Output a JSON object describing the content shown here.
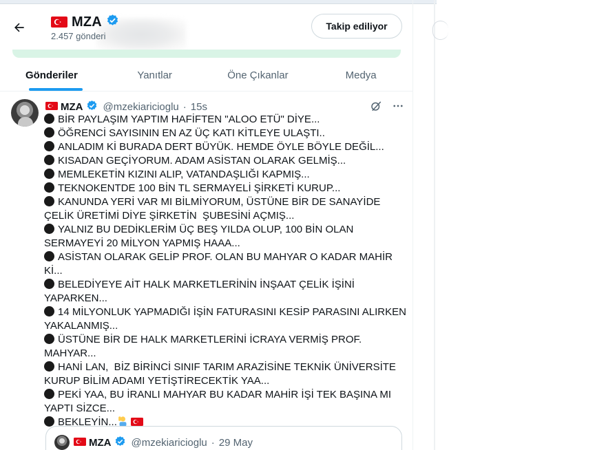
{
  "profile": {
    "display_name": "MZA",
    "post_count": "2.457 gönderi",
    "follow_button": "Takip ediliyor"
  },
  "tabs": [
    {
      "label": "Gönderiler",
      "active": true
    },
    {
      "label": "Yanıtlar",
      "active": false
    },
    {
      "label": "Öne Çıkanlar",
      "active": false
    },
    {
      "label": "Medya",
      "active": false
    }
  ],
  "tweet": {
    "name": "MZA",
    "handle": "@mzekiaricioglu",
    "separator": "·",
    "time": "15s",
    "lines": [
      "BİR PAYLAŞIM YAPTIM HAFİFTEN \"ALOO ETÜ\" DİYE...",
      "ÖĞRENCİ SAYISININ EN AZ ÜÇ KATI KİTLEYE ULAŞTI..",
      "ANLADIM Kİ BURADA DERT BÜYÜK. HEMDE ÖYLE BÖYLE DEĞİL...",
      "KISADAN GEÇİYORUM. ADAM ASİSTAN OLARAK GELMİŞ...",
      "MEMLEKETİN KIZINI ALIP, VATANDAŞLIĞI KAPMIŞ...",
      "TEKNOKENTDE 100 BİN TL SERMAYELİ ŞİRKETİ KURUP...",
      "KANUNDA YERİ VAR MI BİLMİYORUM, ÜSTÜNE BİR DE SANAYİDE ÇELİK ÜRETİMİ DİYE ŞİRKETİN  ŞUBESİNİ AÇMIŞ...",
      "YALNIZ BU DEDİKLERİM ÜÇ BEŞ YILDA OLUP, 100 BİN OLAN SERMAYEYİ 20 MİLYON YAPMIŞ HAAA...",
      "ASİSTAN OLARAK GELİP PROF. OLAN BU MAHYAR O KADAR MAHİR Kİ...",
      "BELEDİYEYE AİT HALK MARKETLERİNİN İNŞAAT ÇELİK İŞİNİ YAPARKEN...",
      "14 MİLYONLUK YAPMADIĞI İŞİN FATURASINI KESİP PARASINI ALIRKEN YAKALANMIŞ...",
      "ÜSTÜNE BİR DE HALK MARKETLERİNİ İCRAYA VERMİŞ PROF. MAHYAR...",
      "HANİ LAN,  BİZ BİRİNCİ SINIF TARIM ARAZİSİNE TEKNİK ÜNİVERSİTE KURUP BİLİM ADAMI YETİŞTİRECEKTİK YAA...",
      "PEKİ YAA, BU İRANLI MAHYAR BU KADAR MAHİR İŞİ TEK BAŞINA MI YAPTI SİZCE...",
      "BEKLEYİN..."
    ]
  },
  "quoted_tweet": {
    "name": "MZA",
    "handle": "@mzekiaricioglu",
    "separator": "·",
    "date": "29 May"
  },
  "icons": {
    "back": "arrow-left-icon",
    "verified": "verified-badge-icon",
    "flag": "turkey-flag-icon",
    "grok": "grok-icon",
    "more": "more-icon",
    "person": "person-emoji-icon"
  },
  "colors": {
    "accent": "#1d9bf0",
    "verified": "#1d9bf0",
    "flag_red": "#e30a17",
    "text_secondary": "#536471"
  }
}
